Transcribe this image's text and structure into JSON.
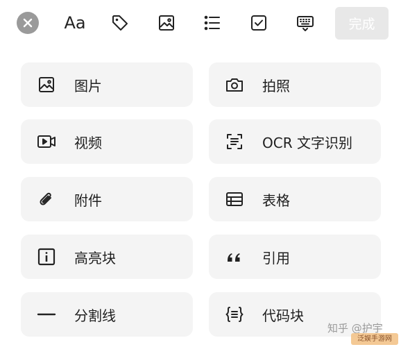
{
  "toolbar": {
    "close_icon": "close-circle-icon",
    "font_label": "Aa",
    "tag_icon": "tag-icon",
    "image_icon": "image-icon",
    "list_icon": "bullet-list-icon",
    "checkbox_icon": "checkbox-icon",
    "keyboard_icon": "keyboard-icon",
    "done_label": "完成",
    "done_button_bg": "#e8e8e8"
  },
  "menu": {
    "items": [
      {
        "label": "图片",
        "icon": "image-icon"
      },
      {
        "label": "拍照",
        "icon": "camera-icon"
      },
      {
        "label": "视频",
        "icon": "video-icon"
      },
      {
        "label": "OCR 文字识别",
        "icon": "scan-text-icon"
      },
      {
        "label": "附件",
        "icon": "paperclip-icon"
      },
      {
        "label": "表格",
        "icon": "table-icon"
      },
      {
        "label": "高亮块",
        "icon": "info-box-icon"
      },
      {
        "label": "引用",
        "icon": "quote-icon"
      },
      {
        "label": "分割线",
        "icon": "divider-icon"
      },
      {
        "label": "代码块",
        "icon": "code-block-icon"
      }
    ]
  },
  "watermark": {
    "text": "知乎 @护宇",
    "badge_text": "泛娱手游网"
  }
}
